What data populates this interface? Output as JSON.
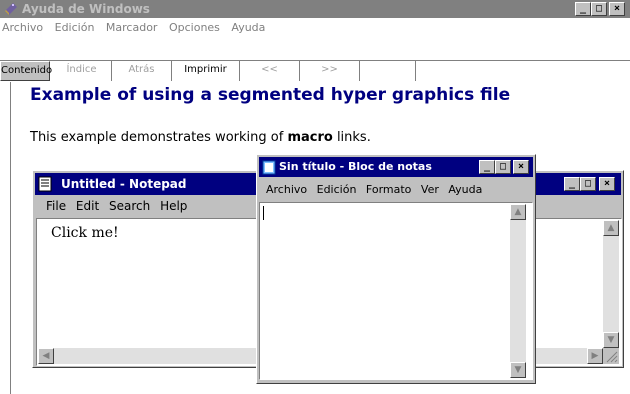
{
  "help": {
    "title": "Ayuda de Windows",
    "menu": [
      "Archivo",
      "Edición",
      "Marcador",
      "Opciones",
      "Ayuda"
    ],
    "toolbar": {
      "contenido": "Contenido",
      "indice": "Índice",
      "atras": "Atrás",
      "imprimir": "Imprimir",
      "prev": "<<",
      "next": ">>"
    },
    "heading": "Example of using a segmented hyper graphics file",
    "body_prefix": "This example demonstrates working of ",
    "body_bold": "macro",
    "body_suffix": " links."
  },
  "notepad_en": {
    "title": "Untitled - Notepad",
    "menu": [
      "File",
      "Edit",
      "Search",
      "Help"
    ],
    "content": "Click me!"
  },
  "notepad_es": {
    "title": "Sin título - Bloc de notas",
    "menu": [
      "Archivo",
      "Edición",
      "Formato",
      "Ver",
      "Ayuda"
    ]
  },
  "colors": {
    "active_title": "#000080",
    "inactive_title": "#808080",
    "heading": "#000080"
  },
  "icons": [
    "help-book-icon",
    "notepad-icon",
    "minimize-icon",
    "maximize-icon",
    "close-icon",
    "scroll-up-icon",
    "scroll-down-icon",
    "scroll-left-icon",
    "scroll-right-icon",
    "size-grip-icon"
  ]
}
